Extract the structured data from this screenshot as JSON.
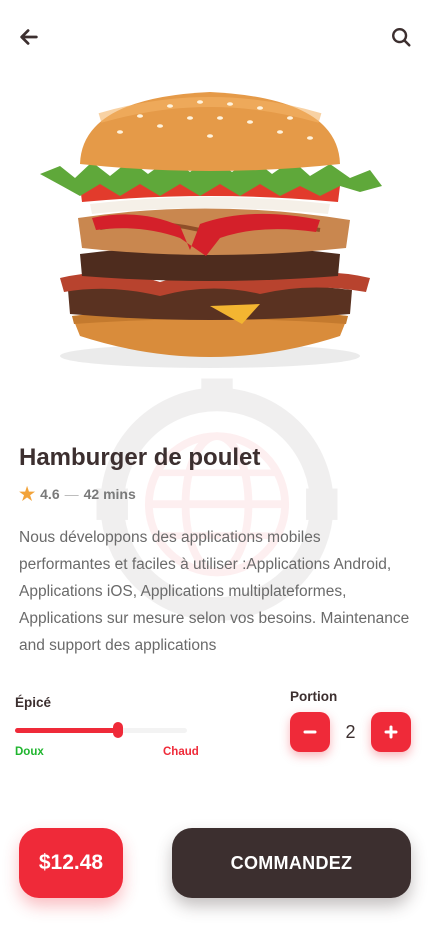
{
  "header": {
    "back_icon": "arrow-left-icon",
    "search_icon": "search-icon"
  },
  "product": {
    "name": "Hamburger de poulet",
    "rating": "4.6",
    "separator": "—",
    "time": "42 mins",
    "description": "Nous développons des applications mobiles performantes et faciles à utiliser :Applications Android, Applications iOS, Applications multiplateformes, Applications sur mesure selon vos besoins. Maintenance and support des applications"
  },
  "spice": {
    "label": "Épicé",
    "min_label": "Doux",
    "max_label": "Chaud",
    "level": 0.6
  },
  "portion": {
    "label": "Portion",
    "quantity": "2"
  },
  "footer": {
    "price": "$12.48",
    "order_label": "COMMANDEZ"
  },
  "colors": {
    "accent": "#ef2a39",
    "dark": "#3c2f2f",
    "mild": "#1fb52e",
    "star": "#f2a33a"
  }
}
